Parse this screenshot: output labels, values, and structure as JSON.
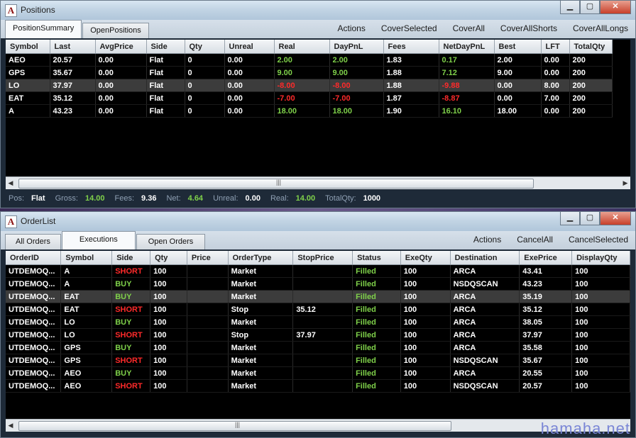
{
  "positions_window": {
    "title": "Positions",
    "tabs": [
      "PositionSummary",
      "OpenPositions"
    ],
    "actions": [
      "Actions",
      "CoverSelected",
      "CoverAll",
      "CoverAllShorts",
      "CoverAllLongs"
    ],
    "columns": [
      "Symbol",
      "Last",
      "AvgPrice",
      "Side",
      "Qty",
      "Unreal",
      "Real",
      "DayPnL",
      "Fees",
      "NetDayPnL",
      "Best",
      "LFT",
      "TotalQty"
    ],
    "rows": [
      [
        "AEO",
        "20.57",
        "0.00",
        "Flat",
        "0",
        "0.00",
        "2.00",
        "2.00",
        "1.83",
        "0.17",
        "2.00",
        "0.00",
        "200"
      ],
      [
        "GPS",
        "35.67",
        "0.00",
        "Flat",
        "0",
        "0.00",
        "9.00",
        "9.00",
        "1.88",
        "7.12",
        "9.00",
        "0.00",
        "200"
      ],
      [
        "LO",
        "37.97",
        "0.00",
        "Flat",
        "0",
        "0.00",
        "-8.00",
        "-8.00",
        "1.88",
        "-9.88",
        "0.00",
        "8.00",
        "200"
      ],
      [
        "EAT",
        "35.12",
        "0.00",
        "Flat",
        "0",
        "0.00",
        "-7.00",
        "-7.00",
        "1.87",
        "-8.87",
        "0.00",
        "7.00",
        "200"
      ],
      [
        "A",
        "43.23",
        "0.00",
        "Flat",
        "0",
        "0.00",
        "18.00",
        "18.00",
        "1.90",
        "16.10",
        "18.00",
        "0.00",
        "200"
      ]
    ],
    "status": {
      "pos_label": "Pos:",
      "pos": "Flat",
      "gross_label": "Gross:",
      "gross": "14.00",
      "fees_label": "Fees:",
      "fees": "9.36",
      "net_label": "Net:",
      "net": "4.64",
      "unreal_label": "Unreal:",
      "unreal": "0.00",
      "real_label": "Real:",
      "real": "14.00",
      "totalqty_label": "TotalQty:",
      "totalqty": "1000"
    }
  },
  "orderlist_window": {
    "title": "OrderList",
    "tabs": [
      "All Orders",
      "Executions",
      "Open Orders"
    ],
    "actions": [
      "Actions",
      "CancelAll",
      "CancelSelected"
    ],
    "columns": [
      "OrderID",
      "Symbol",
      "Side",
      "Qty",
      "Price",
      "OrderType",
      "StopPrice",
      "Status",
      "ExeQty",
      "Destination",
      "ExePrice",
      "DisplayQty"
    ],
    "rows": [
      [
        "UTDEMOQ...",
        "A",
        "SHORT",
        "100",
        "",
        "Market",
        "",
        "Filled",
        "100",
        "ARCA",
        "43.41",
        "100"
      ],
      [
        "UTDEMOQ...",
        "A",
        "BUY",
        "100",
        "",
        "Market",
        "",
        "Filled",
        "100",
        "NSDQSCAN",
        "43.23",
        "100"
      ],
      [
        "UTDEMOQ...",
        "EAT",
        "BUY",
        "100",
        "",
        "Market",
        "",
        "Filled",
        "100",
        "ARCA",
        "35.19",
        "100"
      ],
      [
        "UTDEMOQ...",
        "EAT",
        "SHORT",
        "100",
        "",
        "Stop",
        "35.12",
        "Filled",
        "100",
        "ARCA",
        "35.12",
        "100"
      ],
      [
        "UTDEMOQ...",
        "LO",
        "BUY",
        "100",
        "",
        "Market",
        "",
        "Filled",
        "100",
        "ARCA",
        "38.05",
        "100"
      ],
      [
        "UTDEMOQ...",
        "LO",
        "SHORT",
        "100",
        "",
        "Stop",
        "37.97",
        "Filled",
        "100",
        "ARCA",
        "37.97",
        "100"
      ],
      [
        "UTDEMOQ...",
        "GPS",
        "BUY",
        "100",
        "",
        "Market",
        "",
        "Filled",
        "100",
        "ARCA",
        "35.58",
        "100"
      ],
      [
        "UTDEMOQ...",
        "GPS",
        "SHORT",
        "100",
        "",
        "Market",
        "",
        "Filled",
        "100",
        "NSDQSCAN",
        "35.67",
        "100"
      ],
      [
        "UTDEMOQ...",
        "AEO",
        "BUY",
        "100",
        "",
        "Market",
        "",
        "Filled",
        "100",
        "ARCA",
        "20.55",
        "100"
      ],
      [
        "UTDEMOQ...",
        "AEO",
        "SHORT",
        "100",
        "",
        "Market",
        "",
        "Filled",
        "100",
        "NSDQSCAN",
        "20.57",
        "100"
      ]
    ]
  },
  "watermark": "hamaha.net",
  "colors": {
    "positive": "#7fd14a",
    "negative": "#ff2a2a",
    "buy": "#7fd14a",
    "short": "#ff2a2a",
    "filled": "#7fd14a"
  }
}
